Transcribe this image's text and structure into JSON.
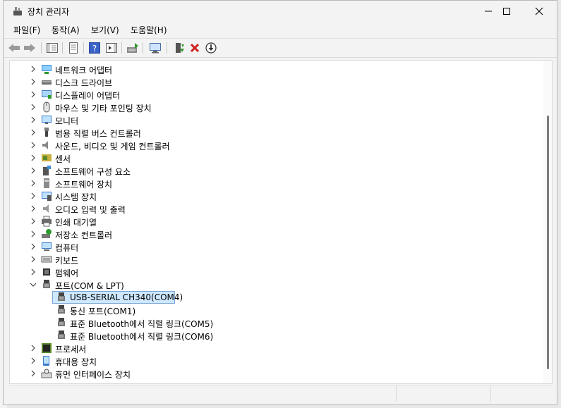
{
  "window": {
    "title": "장치 관리자",
    "menu": [
      "파일(F)",
      "동작(A)",
      "보기(V)",
      "도움말(H)"
    ]
  },
  "tree": {
    "items": [
      {
        "label": "네트워크 어댑터",
        "icon": "network-adapter-icon",
        "expanded": false
      },
      {
        "label": "디스크 드라이브",
        "icon": "disk-drive-icon",
        "expanded": false
      },
      {
        "label": "디스플레이 어댑터",
        "icon": "display-adapter-icon",
        "expanded": false
      },
      {
        "label": "마우스 및 기타 포인팅 장치",
        "icon": "mouse-icon",
        "expanded": false
      },
      {
        "label": "모니터",
        "icon": "monitor-icon",
        "expanded": false
      },
      {
        "label": "범용 직렬 버스 컨트롤러",
        "icon": "usb-controller-icon",
        "expanded": false
      },
      {
        "label": "사운드, 비디오 및 게임 컨트롤러",
        "icon": "sound-icon",
        "expanded": false
      },
      {
        "label": "센서",
        "icon": "sensor-icon",
        "expanded": false
      },
      {
        "label": "소프트웨어 구성 요소",
        "icon": "software-component-icon",
        "expanded": false
      },
      {
        "label": "소프트웨어 장치",
        "icon": "software-device-icon",
        "expanded": false
      },
      {
        "label": "시스템 장치",
        "icon": "system-device-icon",
        "expanded": false
      },
      {
        "label": "오디오 입력 및 출력",
        "icon": "audio-io-icon",
        "expanded": false
      },
      {
        "label": "인쇄 대기열",
        "icon": "printer-icon",
        "expanded": false
      },
      {
        "label": "저장소 컨트롤러",
        "icon": "storage-controller-icon",
        "expanded": false
      },
      {
        "label": "컴퓨터",
        "icon": "computer-icon",
        "expanded": false
      },
      {
        "label": "키보드",
        "icon": "keyboard-icon",
        "expanded": false
      },
      {
        "label": "펌웨어",
        "icon": "firmware-icon",
        "expanded": false
      },
      {
        "label": "포트(COM & LPT)",
        "icon": "port-icon",
        "expanded": true
      },
      {
        "label": "USB-SERIAL CH340(COM4)",
        "icon": "port-icon",
        "child": true,
        "selected": true
      },
      {
        "label": "통신 포트(COM1)",
        "icon": "port-icon",
        "child": true
      },
      {
        "label": "표준 Bluetooth에서 직렬 링크(COM5)",
        "icon": "port-icon",
        "child": true
      },
      {
        "label": "표준 Bluetooth에서 직렬 링크(COM6)",
        "icon": "port-icon",
        "child": true
      },
      {
        "label": "프로세서",
        "icon": "processor-icon",
        "expanded": false
      },
      {
        "label": "휴대용 장치",
        "icon": "portable-device-icon",
        "expanded": false
      },
      {
        "label": "휴먼 인터페이스 장치",
        "icon": "hid-icon",
        "expanded": false
      }
    ]
  },
  "colors": {
    "selection": "#cde8ff",
    "selection_border": "#7aa7d6",
    "accent_red": "#d11f1f",
    "accent_blue": "#2b6fd6"
  }
}
